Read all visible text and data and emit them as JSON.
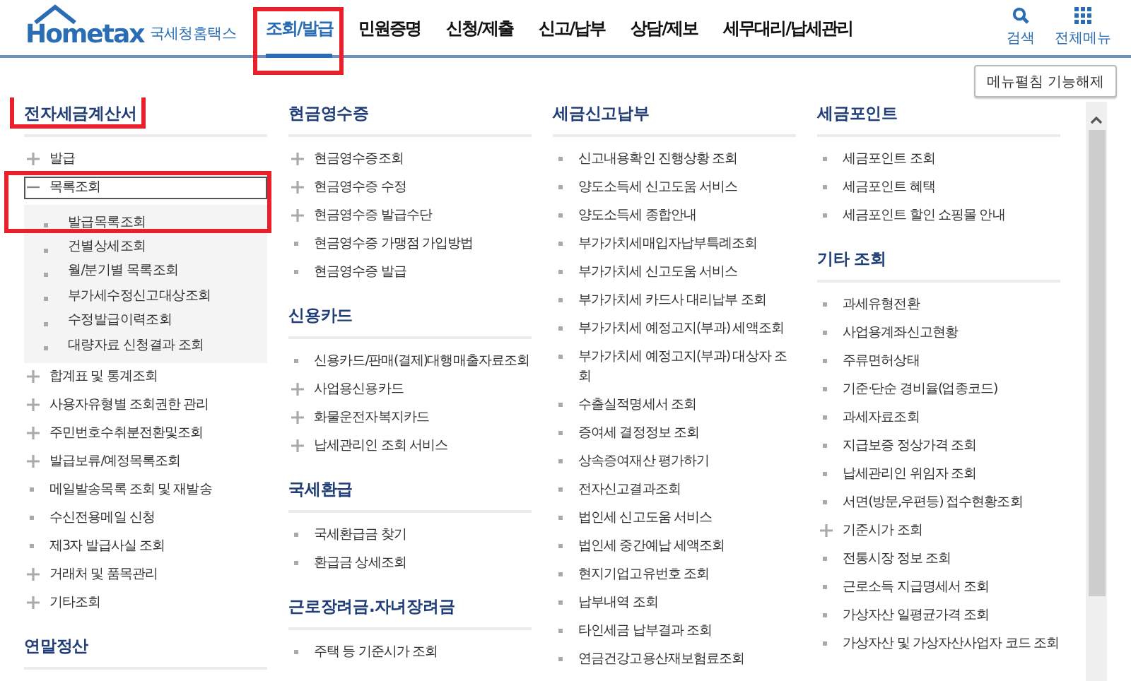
{
  "logo": {
    "brand": "Hometax",
    "subtitle": "국세청홈택스"
  },
  "nav": [
    {
      "label": "조회/발급",
      "selected": true,
      "highlighted": true
    },
    {
      "label": "민원증명",
      "selected": false
    },
    {
      "label": "신청/제출",
      "selected": false
    },
    {
      "label": "신고/납부",
      "selected": false
    },
    {
      "label": "상담/제보",
      "selected": false
    },
    {
      "label": "세무대리/납세관리",
      "selected": false
    }
  ],
  "tools": [
    {
      "kind": "search",
      "label": "검색"
    },
    {
      "kind": "menu",
      "label": "전체메뉴"
    }
  ],
  "collapse_button": "메뉴펼침 기능해제",
  "columns": [
    {
      "sections": [
        {
          "title": "전자세금계산서",
          "highlighted": true,
          "items": [
            {
              "label": "발급",
              "kind": "group",
              "expanded": false
            },
            {
              "label": "목록조회",
              "kind": "group",
              "expanded": true,
              "focused": true,
              "highlighted": true,
              "children": [
                "발급목록조회",
                "건별상세조회",
                "월/분기별 목록조회",
                "부가세수정신고대상조회",
                "수정발급이력조회",
                "대량자료 신청결과 조회"
              ]
            },
            {
              "label": "합계표 및 통계조회",
              "kind": "group",
              "expanded": false
            },
            {
              "label": "사용자유형별 조회권한 관리",
              "kind": "group",
              "expanded": false
            },
            {
              "label": "주민번호수취분전환및조회",
              "kind": "group",
              "expanded": false
            },
            {
              "label": "발급보류/예정목록조회",
              "kind": "group",
              "expanded": false
            },
            {
              "label": "메일발송목록 조회 및 재발송",
              "kind": "link"
            },
            {
              "label": "수신전용메일 신청",
              "kind": "link"
            },
            {
              "label": "제3자 발급사실 조회",
              "kind": "link"
            },
            {
              "label": "거래처 및 품목관리",
              "kind": "group",
              "expanded": false
            },
            {
              "label": "기타조회",
              "kind": "group",
              "expanded": false
            }
          ]
        },
        {
          "title": "연말정산"
        }
      ]
    },
    {
      "sections": [
        {
          "title": "현금영수증",
          "items": [
            {
              "label": "현금영수증조회",
              "kind": "group",
              "expanded": false
            },
            {
              "label": "현금영수증 수정",
              "kind": "group",
              "expanded": false
            },
            {
              "label": "현금영수증 발급수단",
              "kind": "group",
              "expanded": false
            },
            {
              "label": "현금영수증 가맹점 가입방법",
              "kind": "link"
            },
            {
              "label": "현금영수증 발급",
              "kind": "link"
            }
          ]
        },
        {
          "title": "신용카드",
          "items": [
            {
              "label": "신용카드/판매(결제)대행매출자료조회",
              "kind": "link"
            },
            {
              "label": "사업용신용카드",
              "kind": "group",
              "expanded": false
            },
            {
              "label": "화물운전자복지카드",
              "kind": "group",
              "expanded": false
            },
            {
              "label": "납세관리인 조회 서비스",
              "kind": "group",
              "expanded": false
            }
          ]
        },
        {
          "title": "국세환급",
          "items": [
            {
              "label": "국세환급금 찾기",
              "kind": "link"
            },
            {
              "label": "환급금 상세조회",
              "kind": "link"
            }
          ]
        },
        {
          "title": "근로장려금.자녀장려금",
          "items": [
            {
              "label": "주택 등 기준시가 조회",
              "kind": "link"
            }
          ]
        }
      ]
    },
    {
      "sections": [
        {
          "title": "세금신고납부",
          "items": [
            {
              "label": "신고내용확인 진행상황 조회",
              "kind": "link"
            },
            {
              "label": "양도소득세 신고도움 서비스",
              "kind": "link"
            },
            {
              "label": "양도소득세 종합안내",
              "kind": "link"
            },
            {
              "label": "부가가치세매입자납부특례조회",
              "kind": "link"
            },
            {
              "label": "부가가치세 신고도움 서비스",
              "kind": "link"
            },
            {
              "label": "부가가치세 카드사 대리납부 조회",
              "kind": "link"
            },
            {
              "label": "부가가치세 예정고지(부과) 세액조회",
              "kind": "link"
            },
            {
              "label": "부가가치세 예정고지(부과) 대상자 조회",
              "kind": "link"
            },
            {
              "label": "수출실적명세서 조회",
              "kind": "link"
            },
            {
              "label": "증여세 결정정보 조회",
              "kind": "link"
            },
            {
              "label": "상속증여재산 평가하기",
              "kind": "link"
            },
            {
              "label": "전자신고결과조회",
              "kind": "link"
            },
            {
              "label": "법인세 신고도움 서비스",
              "kind": "link"
            },
            {
              "label": "법인세 중간예납 세액조회",
              "kind": "link"
            },
            {
              "label": "현지기업고유번호 조회",
              "kind": "link"
            },
            {
              "label": "납부내역 조회",
              "kind": "link"
            },
            {
              "label": "타인세금 납부결과 조회",
              "kind": "link"
            },
            {
              "label": "연금건강고용산재보험료조회",
              "kind": "link"
            }
          ]
        }
      ]
    },
    {
      "sections": [
        {
          "title": "세금포인트",
          "items": [
            {
              "label": "세금포인트 조회",
              "kind": "link"
            },
            {
              "label": "세금포인트 혜택",
              "kind": "link"
            },
            {
              "label": "세금포인트 할인 쇼핑몰 안내",
              "kind": "link"
            }
          ]
        },
        {
          "title": "기타 조회",
          "items": [
            {
              "label": "과세유형전환",
              "kind": "link"
            },
            {
              "label": "사업용계좌신고현황",
              "kind": "link"
            },
            {
              "label": "주류면허상태",
              "kind": "link"
            },
            {
              "label": "기준·단순 경비율(업종코드)",
              "kind": "link"
            },
            {
              "label": "과세자료조회",
              "kind": "link"
            },
            {
              "label": "지급보증 정상가격 조회",
              "kind": "link"
            },
            {
              "label": "납세관리인 위임자 조회",
              "kind": "link"
            },
            {
              "label": "서면(방문,우편등) 접수현황조회",
              "kind": "link"
            },
            {
              "label": "기준시가 조회",
              "kind": "group",
              "expanded": false
            },
            {
              "label": "전통시장 정보 조회",
              "kind": "link"
            },
            {
              "label": "근로소득 지급명세서 조회",
              "kind": "link"
            },
            {
              "label": "가상자산 일평균가격 조회",
              "kind": "link"
            },
            {
              "label": "가상자산 및 가상자산사업자 코드 조회",
              "kind": "link"
            }
          ]
        }
      ]
    }
  ]
}
